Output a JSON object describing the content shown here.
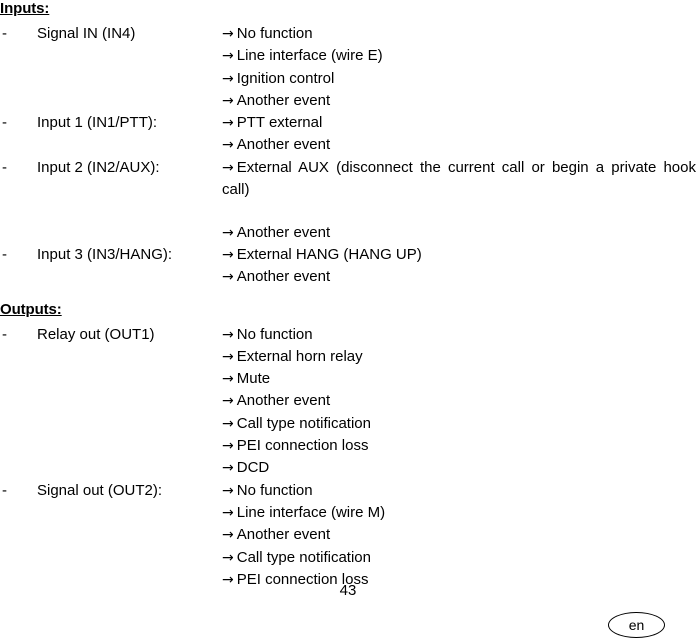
{
  "document": {
    "page_number": "43",
    "language_badge": "en",
    "bullet_marker": "-",
    "arrow_glyph": "→"
  },
  "sections": [
    {
      "heading": "Inputs:",
      "entries": [
        {
          "label": "Signal IN (IN4)",
          "values": [
            "No function",
            "Line interface (wire E)",
            "Ignition control",
            "Another event"
          ]
        },
        {
          "label": "Input 1 (IN1/PTT):",
          "values": [
            "PTT external",
            "Another event"
          ]
        },
        {
          "label": "Input 2 (IN2/AUX):",
          "values": [
            "External AUX (disconnect the current call or begin a private hook call)",
            "Another event"
          ],
          "wrap_first": true
        },
        {
          "label": "Input 3 (IN3/HANG):",
          "values": [
            "External HANG (HANG UP)",
            "Another event"
          ]
        }
      ]
    },
    {
      "heading": "Outputs:",
      "entries": [
        {
          "label": "Relay out (OUT1)",
          "values": [
            "No function",
            "External horn relay",
            "Mute",
            "Another event",
            "Call type notification",
            "PEI connection loss",
            "DCD"
          ]
        },
        {
          "label": "Signal out (OUT2):",
          "values": [
            "No function",
            "Line interface (wire M)",
            "Another event",
            "Call type notification",
            "PEI connection loss"
          ]
        }
      ]
    }
  ]
}
